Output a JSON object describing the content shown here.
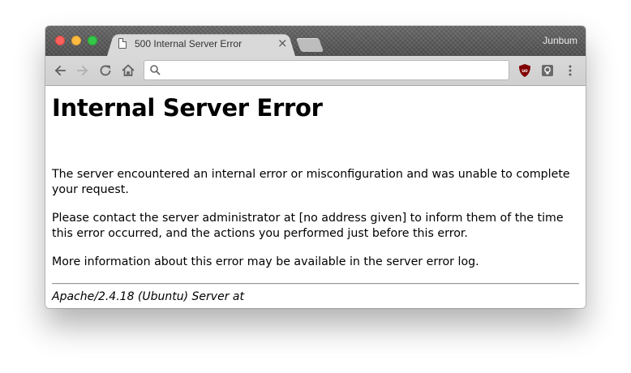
{
  "browser": {
    "tab": {
      "title": "500 Internal Server Error",
      "close_glyph": "×",
      "page_icon": "document-icon"
    },
    "profile_name": "Junbum",
    "toolbar": {
      "back_icon": "arrow-left-icon",
      "forward_icon": "arrow-right-icon",
      "reload_icon": "reload-icon",
      "home_icon": "home-icon",
      "omnibox": {
        "value": "",
        "icon": "search-icon"
      },
      "extensions": [
        "ublock-icon",
        "lightbulb-icon"
      ],
      "menu_icon": "kebab-menu-icon"
    },
    "window_controls": {
      "close_color": "#fc605c",
      "minimize_color": "#fdbc40",
      "maximize_color": "#34c84a"
    }
  },
  "page": {
    "heading": "Internal Server Error",
    "paragraphs": [
      "The server encountered an internal error or misconfiguration and was unable to complete your request.",
      "Please contact the server administrator at [no address given] to inform them of the time this error occurred, and the actions you performed just before this error.",
      "More information about this error may be available in the server error log."
    ],
    "address": "Apache/2.4.18 (Ubuntu) Server at"
  }
}
